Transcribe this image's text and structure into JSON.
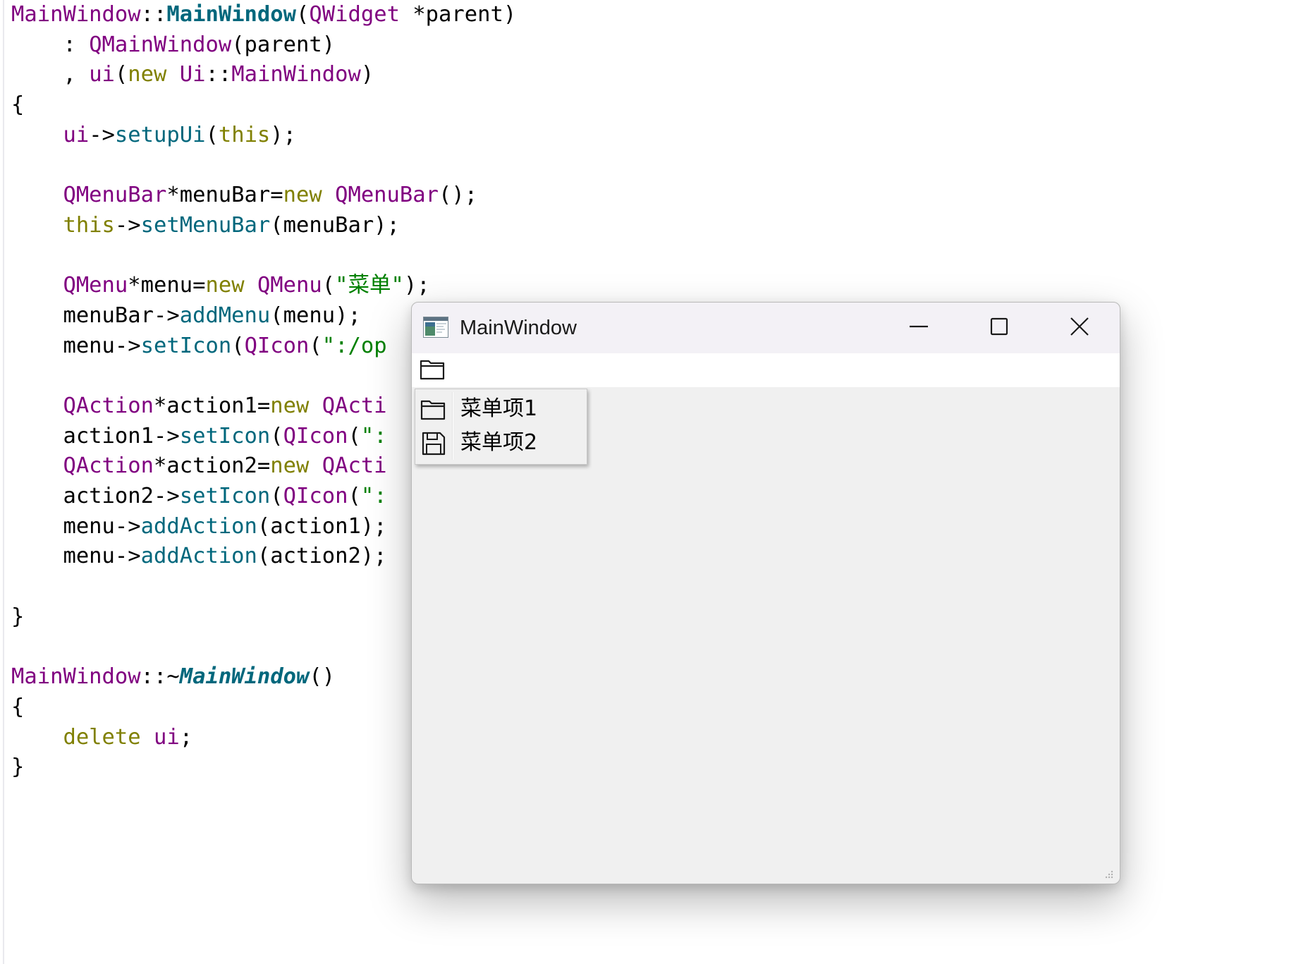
{
  "editor": {
    "lines": [
      [
        {
          "t": "MainWindow",
          "c": "cls"
        },
        {
          "t": "::",
          "c": "pl"
        },
        {
          "t": "MainWindow",
          "c": "fnb"
        },
        {
          "t": "(",
          "c": "pl"
        },
        {
          "t": "QWidget",
          "c": "cls"
        },
        {
          "t": " *parent)",
          "c": "pl"
        }
      ],
      [
        {
          "t": "    : ",
          "c": "pl"
        },
        {
          "t": "QMainWindow",
          "c": "cls"
        },
        {
          "t": "(parent)",
          "c": "pl"
        }
      ],
      [
        {
          "t": "    , ",
          "c": "pl"
        },
        {
          "t": "ui",
          "c": "cls"
        },
        {
          "t": "(",
          "c": "pl"
        },
        {
          "t": "new",
          "c": "kw"
        },
        {
          "t": " ",
          "c": "pl"
        },
        {
          "t": "Ui",
          "c": "cls"
        },
        {
          "t": "::",
          "c": "pl"
        },
        {
          "t": "MainWindow",
          "c": "cls"
        },
        {
          "t": ")",
          "c": "pl"
        }
      ],
      [
        {
          "t": "{",
          "c": "pl"
        }
      ],
      [
        {
          "t": "    ",
          "c": "pl"
        },
        {
          "t": "ui",
          "c": "cls"
        },
        {
          "t": "->",
          "c": "pl"
        },
        {
          "t": "setupUi",
          "c": "fn"
        },
        {
          "t": "(",
          "c": "pl"
        },
        {
          "t": "this",
          "c": "kw"
        },
        {
          "t": ");",
          "c": "pl"
        }
      ],
      [],
      [
        {
          "t": "    ",
          "c": "pl"
        },
        {
          "t": "QMenuBar",
          "c": "cls"
        },
        {
          "t": "*menuBar=",
          "c": "pl"
        },
        {
          "t": "new",
          "c": "kw"
        },
        {
          "t": " ",
          "c": "pl"
        },
        {
          "t": "QMenuBar",
          "c": "cls"
        },
        {
          "t": "();",
          "c": "pl"
        }
      ],
      [
        {
          "t": "    ",
          "c": "pl"
        },
        {
          "t": "this",
          "c": "kw"
        },
        {
          "t": "->",
          "c": "pl"
        },
        {
          "t": "setMenuBar",
          "c": "fn"
        },
        {
          "t": "(menuBar);",
          "c": "pl"
        }
      ],
      [],
      [
        {
          "t": "    ",
          "c": "pl"
        },
        {
          "t": "QMenu",
          "c": "cls"
        },
        {
          "t": "*menu=",
          "c": "pl"
        },
        {
          "t": "new",
          "c": "kw"
        },
        {
          "t": " ",
          "c": "pl"
        },
        {
          "t": "QMenu",
          "c": "cls"
        },
        {
          "t": "(",
          "c": "pl"
        },
        {
          "t": "\"菜单\"",
          "c": "str"
        },
        {
          "t": ");",
          "c": "pl"
        }
      ],
      [
        {
          "t": "    menuBar->",
          "c": "pl"
        },
        {
          "t": "addMenu",
          "c": "fn"
        },
        {
          "t": "(menu);",
          "c": "pl"
        }
      ],
      [
        {
          "t": "    menu->",
          "c": "pl"
        },
        {
          "t": "setIcon",
          "c": "fn"
        },
        {
          "t": "(",
          "c": "pl"
        },
        {
          "t": "QIcon",
          "c": "cls"
        },
        {
          "t": "(",
          "c": "pl"
        },
        {
          "t": "\":/op",
          "c": "str"
        }
      ],
      [],
      [
        {
          "t": "    ",
          "c": "pl"
        },
        {
          "t": "QAction",
          "c": "cls"
        },
        {
          "t": "*action1=",
          "c": "pl"
        },
        {
          "t": "new",
          "c": "kw"
        },
        {
          "t": " ",
          "c": "pl"
        },
        {
          "t": "QActi",
          "c": "cls"
        }
      ],
      [
        {
          "t": "    action1->",
          "c": "pl"
        },
        {
          "t": "setIcon",
          "c": "fn"
        },
        {
          "t": "(",
          "c": "pl"
        },
        {
          "t": "QIcon",
          "c": "cls"
        },
        {
          "t": "(",
          "c": "pl"
        },
        {
          "t": "\":",
          "c": "str"
        }
      ],
      [
        {
          "t": "    ",
          "c": "pl"
        },
        {
          "t": "QAction",
          "c": "cls"
        },
        {
          "t": "*action2=",
          "c": "pl"
        },
        {
          "t": "new",
          "c": "kw"
        },
        {
          "t": " ",
          "c": "pl"
        },
        {
          "t": "QActi",
          "c": "cls"
        }
      ],
      [
        {
          "t": "    action2->",
          "c": "pl"
        },
        {
          "t": "setIcon",
          "c": "fn"
        },
        {
          "t": "(",
          "c": "pl"
        },
        {
          "t": "QIcon",
          "c": "cls"
        },
        {
          "t": "(",
          "c": "pl"
        },
        {
          "t": "\":",
          "c": "str"
        }
      ],
      [
        {
          "t": "    menu->",
          "c": "pl"
        },
        {
          "t": "addAction",
          "c": "fn"
        },
        {
          "t": "(action1);",
          "c": "pl"
        }
      ],
      [
        {
          "t": "    menu->",
          "c": "pl"
        },
        {
          "t": "addAction",
          "c": "fn"
        },
        {
          "t": "(action2);",
          "c": "pl"
        }
      ],
      [],
      [
        {
          "t": "}",
          "c": "pl"
        }
      ],
      [],
      [
        {
          "t": "MainWindow",
          "c": "cls"
        },
        {
          "t": "::~",
          "c": "pl"
        },
        {
          "t": "MainWindow",
          "c": "fni"
        },
        {
          "t": "()",
          "c": "pl"
        }
      ],
      [
        {
          "t": "{",
          "c": "pl"
        }
      ],
      [
        {
          "t": "    ",
          "c": "pl"
        },
        {
          "t": "delete",
          "c": "kw"
        },
        {
          "t": " ",
          "c": "pl"
        },
        {
          "t": "ui",
          "c": "cls"
        },
        {
          "t": ";",
          "c": "pl"
        }
      ],
      [
        {
          "t": "}",
          "c": "pl"
        }
      ]
    ],
    "colors": {
      "cls": "#800080",
      "fn": "#00677c",
      "kw": "#808000",
      "str": "#008000",
      "pl": "#000000"
    }
  },
  "window": {
    "title": "MainWindow",
    "icon": "app-window-icon",
    "controls": {
      "minimize": "minimize-icon",
      "maximize": "maximize-icon",
      "close": "close-icon"
    },
    "menubar": {
      "menu_icon": "folder-icon"
    },
    "dropdown": {
      "items": [
        {
          "label": "菜单项1",
          "icon": "folder-icon"
        },
        {
          "label": "菜单项2",
          "icon": "save-icon"
        }
      ]
    }
  }
}
